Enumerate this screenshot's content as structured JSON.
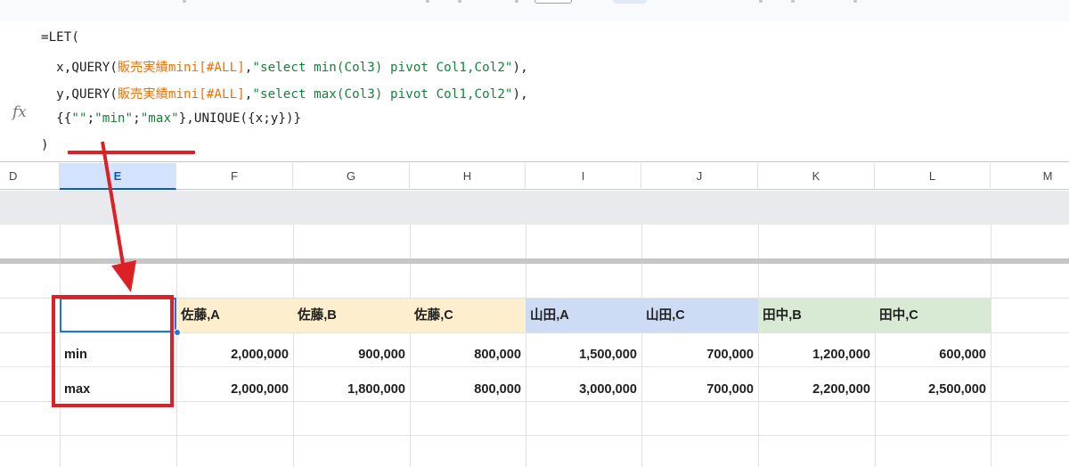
{
  "formula": {
    "fx_icon": "fx",
    "line1": "=LET(",
    "line2": {
      "pre": "  x,QUERY(",
      "range": "販売実績mini[#ALL]",
      "mid": ",",
      "str": "\"select min(Col3) pivot Col1,Col2\"",
      "post": "),"
    },
    "line3": {
      "pre": "  y,QUERY(",
      "range": "販売実績mini[#ALL]",
      "mid": ",",
      "str": "\"select max(Col3) pivot Col1,Col2\"",
      "post": "),"
    },
    "line4": {
      "pre": "  {{",
      "s1": "\"\"",
      "sep1": ";",
      "s2": "\"min\"",
      "sep2": ";",
      "s3": "\"max\"",
      "post": "},UNIQUE({x;y})}"
    },
    "line5": ")"
  },
  "columns": [
    "D",
    "E",
    "F",
    "G",
    "H",
    "I",
    "J",
    "K",
    "L",
    "M"
  ],
  "active_column": "E",
  "table": {
    "headers": [
      "",
      "佐藤,A",
      "佐藤,B",
      "佐藤,C",
      "山田,A",
      "山田,C",
      "田中,B",
      "田中,C"
    ],
    "header_colors": [
      "#ffffff",
      "#fdeecd",
      "#fdeecd",
      "#fdeecd",
      "#cddcf4",
      "#cddcf4",
      "#d8ead3",
      "#d8ead3"
    ],
    "rows": [
      {
        "label": "min",
        "values": [
          "2,000,000",
          "900,000",
          "800,000",
          "1,500,000",
          "700,000",
          "1,200,000",
          "600,000"
        ]
      },
      {
        "label": "max",
        "values": [
          "2,000,000",
          "1,800,000",
          "800,000",
          "3,000,000",
          "700,000",
          "2,200,000",
          "2,500,000"
        ]
      }
    ]
  },
  "colors": {
    "annotation_red": "#dd1f26",
    "selection_blue": "#1a73e8",
    "range_orange": "#e8710a",
    "string_green": "#188038"
  }
}
